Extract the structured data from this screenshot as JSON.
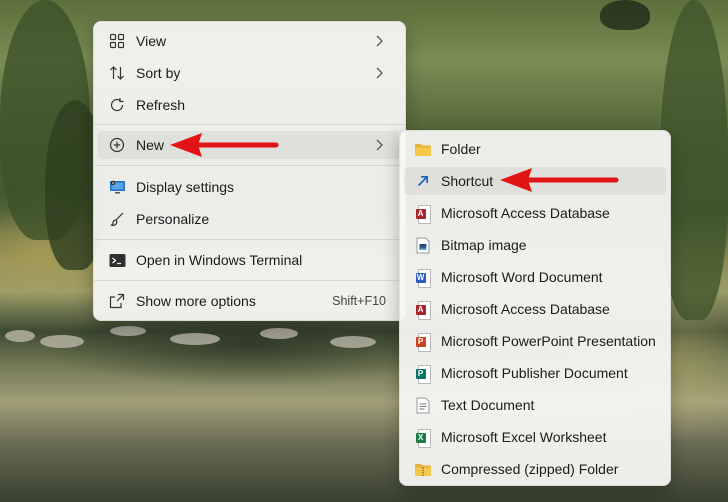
{
  "main_menu": {
    "items": [
      {
        "label": "View",
        "icon": "grid-view-icon",
        "has_submenu": true
      },
      {
        "label": "Sort by",
        "icon": "sort-icon",
        "has_submenu": true
      },
      {
        "label": "Refresh",
        "icon": "refresh-icon",
        "has_submenu": false
      },
      {
        "label": "New",
        "icon": "plus-circle-icon",
        "has_submenu": true,
        "highlighted": true
      },
      {
        "label": "Display settings",
        "icon": "display-icon",
        "has_submenu": false
      },
      {
        "label": "Personalize",
        "icon": "brush-icon",
        "has_submenu": false
      },
      {
        "label": "Open in Windows Terminal",
        "icon": "terminal-icon",
        "has_submenu": false
      },
      {
        "label": "Show more options",
        "icon": "show-more-icon",
        "shortcut": "Shift+F10"
      }
    ]
  },
  "new_submenu": {
    "items": [
      {
        "label": "Folder",
        "icon": "folder-icon"
      },
      {
        "label": "Shortcut",
        "icon": "shortcut-icon",
        "highlighted": true
      },
      {
        "label": "Microsoft Access Database",
        "icon": "access-icon"
      },
      {
        "label": "Bitmap image",
        "icon": "bitmap-icon"
      },
      {
        "label": "Microsoft Word Document",
        "icon": "word-icon"
      },
      {
        "label": "Microsoft Access Database",
        "icon": "access-icon"
      },
      {
        "label": "Microsoft PowerPoint Presentation",
        "icon": "powerpoint-icon"
      },
      {
        "label": "Microsoft Publisher Document",
        "icon": "publisher-icon"
      },
      {
        "label": "Text Document",
        "icon": "text-document-icon"
      },
      {
        "label": "Microsoft Excel Worksheet",
        "icon": "excel-icon"
      },
      {
        "label": "Compressed (zipped) Folder",
        "icon": "zip-folder-icon"
      }
    ]
  },
  "annotation": {
    "arrow_color": "#e01414"
  },
  "colors": {
    "word": "#2b5fbf",
    "excel": "#1d7a44",
    "powerpoint": "#c8431f",
    "access": "#a4262c",
    "publisher": "#077568",
    "folder": "#f3c84b"
  }
}
